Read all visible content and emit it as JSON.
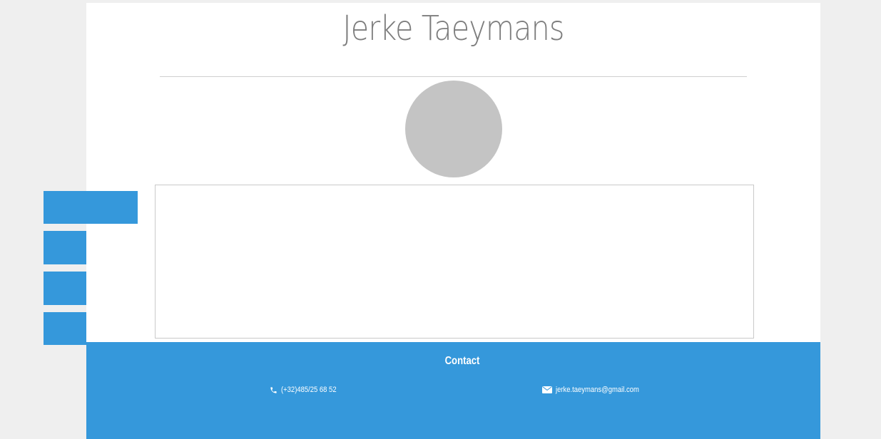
{
  "header": {
    "name": "Jerke Taeymans"
  },
  "profile": {
    "avatar_icon": "avatar-placeholder"
  },
  "side_nav": {
    "items": [
      {
        "icon": "nav-item-1"
      },
      {
        "icon": "nav-item-2"
      },
      {
        "icon": "nav-item-3"
      },
      {
        "icon": "nav-item-4"
      }
    ]
  },
  "footer": {
    "heading": "Contact",
    "phone": "(+32)485/25 68 52",
    "email": "jerke.taeymans@gmail.com",
    "phone_icon": "phone-icon",
    "email_icon": "envelope-icon"
  },
  "colors": {
    "accent": "#3598db",
    "background": "#efefef",
    "avatar": "#c4c4c4",
    "title": "#7d7d7d"
  }
}
